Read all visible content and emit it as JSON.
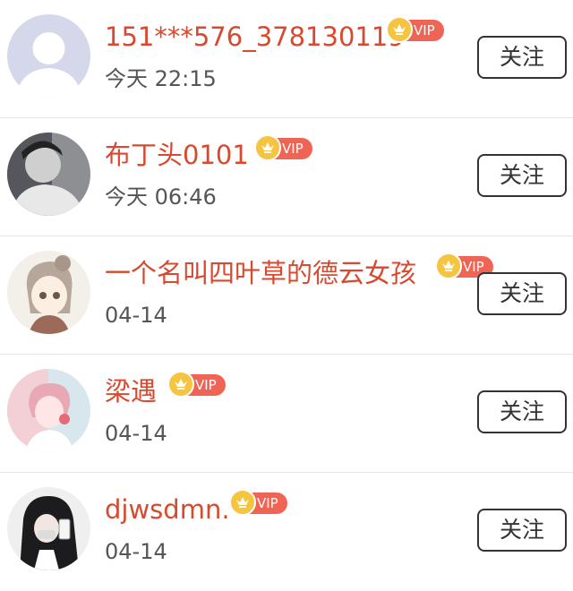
{
  "users": [
    {
      "name": "151***576_378130119",
      "badge": "VIP",
      "time": "今天 22:15",
      "follow_label": "关注"
    },
    {
      "name": "布丁头0101",
      "badge": "VIP",
      "time": "今天 06:46",
      "follow_label": "关注"
    },
    {
      "name": "一个名叫四叶草的德云女孩",
      "badge": "VIP",
      "time": "04-14",
      "follow_label": "关注"
    },
    {
      "name": "梁遇",
      "badge": "VIP",
      "time": "04-14",
      "follow_label": "关注"
    },
    {
      "name": "djwsdmn.",
      "badge": "VIP",
      "time": "04-14",
      "follow_label": "关注"
    }
  ],
  "colors": {
    "name": "#d8492f",
    "vip_badge": "#ef6454",
    "crown": "#f5c441",
    "divider": "#e6e6e6"
  },
  "icons": [
    "crown-icon"
  ]
}
